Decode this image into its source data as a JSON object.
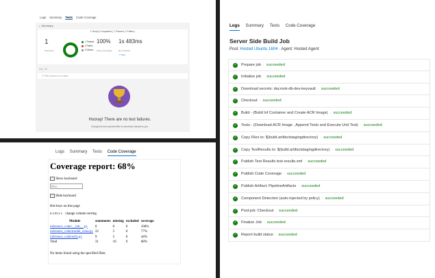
{
  "tests_panel": {
    "tabs": [
      "Logs",
      "Summary",
      "Tests",
      "Code Coverage"
    ],
    "active_tab": "Tests",
    "summary_header": "Summary",
    "summary_title": "1 Run(s) Completed ( 1 Passed, 0 Failed )",
    "total_tests": "1",
    "total_tests_label": "Total tests",
    "legend": [
      {
        "label": "Passed",
        "count": "1",
        "color": "#107c10"
      },
      {
        "label": "Failed",
        "count": "0",
        "color": "#d13438"
      },
      {
        "label": "Others",
        "count": "0",
        "color": "#8a8886"
      }
    ],
    "pass_percent": "100%",
    "pass_label": "Pass percentage",
    "duration": "1s 483ms",
    "duration_label": "Run duration",
    "view_link": "View",
    "filter_row": "Any  ·  All",
    "filter_placeholder": "Filter by test or run name",
    "hooray": "Hooray! There are no test failures.",
    "hint": "Change the test outcome filter to view tests relevant to you."
  },
  "coverage_panel": {
    "tabs": [
      "Logs",
      "Summary",
      "Tests",
      "Code Coverage"
    ],
    "active_tab": "Code Coverage",
    "title": "Coverage report: 68%",
    "show_keyboard": "Show keyboard",
    "filter_placeholder": "filter...",
    "hide_keyboard": "Hide keyboard",
    "hotkeys_title": "Hot-keys on this page",
    "hotkeys_keys": "n s m x c",
    "hotkeys_desc": "change column sorting",
    "columns": [
      "Module",
      "statements",
      "missing",
      "excluded",
      "coverage"
    ],
    "rows": [
      [
        "inference_code/__init__.py",
        "0",
        "0",
        "0",
        "100%"
      ],
      [
        "inference_code/model_class.py",
        "22",
        "5",
        "0",
        "77%"
      ],
      [
        "inference_code/utils.py",
        "9",
        "5",
        "0",
        "44%"
      ]
    ],
    "total": [
      "Total",
      "31",
      "10",
      "0",
      "68%"
    ],
    "no_items": "No items found using the specified filter."
  },
  "pipeline_panel": {
    "tabs": [
      "Logs",
      "Summary",
      "Tests",
      "Code Coverage"
    ],
    "active_tab": "Logs",
    "job_title": "Server Side Build Job",
    "pool_label": "Pool:",
    "pool_name": "Hosted Ubuntu 1604",
    "agent": "· Agent: Hosted Agent",
    "status_color": "#107c10",
    "steps": [
      {
        "name": "Prepare job",
        "status": "succeeded"
      },
      {
        "name": "Initialize job",
        "status": "succeeded"
      },
      {
        "name": "Download secrets: dacrook-db-dev-keyvault",
        "status": "succeeded"
      },
      {
        "name": "Checkout",
        "status": "succeeded"
      },
      {
        "name": "Build - (Build Inf Container and Create ACR Image)",
        "status": "succeeded"
      },
      {
        "name": "Tests - (Download ACR Image , Append Tests and Execute Unit Test)",
        "status": "succeeded"
      },
      {
        "name": "Copy Files to: $(build.artifactstagingdirectory)",
        "status": "succeeded"
      },
      {
        "name": "Copy TestResults to: $(build.artifactstagingdirectory)",
        "status": "succeeded"
      },
      {
        "name": "Publish Test Results test-results.xml",
        "status": "succeeded"
      },
      {
        "name": "Publish Code Coverage",
        "status": "succeeded"
      },
      {
        "name": "Publish Artifact: PipelineArtifacts",
        "status": "succeeded"
      },
      {
        "name": "Component Detection (auto-injected by policy)",
        "status": "succeeded"
      },
      {
        "name": "Post-job: Checkout",
        "status": "succeeded"
      },
      {
        "name": "Finalize Job",
        "status": "succeeded"
      },
      {
        "name": "Report build status",
        "status": "succeeded"
      }
    ]
  }
}
